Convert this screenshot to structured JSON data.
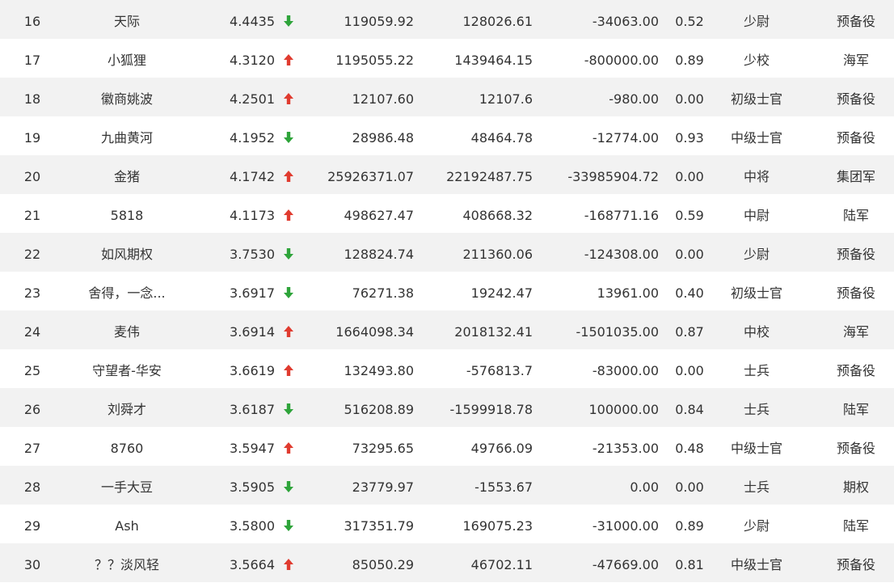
{
  "colors": {
    "up": "#e03b2f",
    "down": "#2ea43a",
    "row_stripe": "#f2f2f2",
    "text": "#333333"
  },
  "rows": [
    {
      "rank": "16",
      "name": "天际",
      "score": "4.4435",
      "trend": "down",
      "value1": "119059.92",
      "value2": "128026.61",
      "value3": "-34063.00",
      "ratio": "0.52",
      "title": "少尉",
      "unit": "预备役"
    },
    {
      "rank": "17",
      "name": "小狐狸",
      "score": "4.3120",
      "trend": "up",
      "value1": "1195055.22",
      "value2": "1439464.15",
      "value3": "-800000.00",
      "ratio": "0.89",
      "title": "少校",
      "unit": "海军"
    },
    {
      "rank": "18",
      "name": "徽商姚波",
      "score": "4.2501",
      "trend": "up",
      "value1": "12107.60",
      "value2": "12107.6",
      "value3": "-980.00",
      "ratio": "0.00",
      "title": "初级士官",
      "unit": "预备役"
    },
    {
      "rank": "19",
      "name": "九曲黄河",
      "score": "4.1952",
      "trend": "down",
      "value1": "28986.48",
      "value2": "48464.78",
      "value3": "-12774.00",
      "ratio": "0.93",
      "title": "中级士官",
      "unit": "预备役"
    },
    {
      "rank": "20",
      "name": "金猪",
      "score": "4.1742",
      "trend": "up",
      "value1": "25926371.07",
      "value2": "22192487.75",
      "value3": "-33985904.72",
      "ratio": "0.00",
      "title": "中将",
      "unit": "集团军"
    },
    {
      "rank": "21",
      "name": "5818",
      "score": "4.1173",
      "trend": "up",
      "value1": "498627.47",
      "value2": "408668.32",
      "value3": "-168771.16",
      "ratio": "0.59",
      "title": "中尉",
      "unit": "陆军"
    },
    {
      "rank": "22",
      "name": "如风期权",
      "score": "3.7530",
      "trend": "down",
      "value1": "128824.74",
      "value2": "211360.06",
      "value3": "-124308.00",
      "ratio": "0.00",
      "title": "少尉",
      "unit": "预备役"
    },
    {
      "rank": "23",
      "name": "舍得，一念...",
      "score": "3.6917",
      "trend": "down",
      "value1": "76271.38",
      "value2": "19242.47",
      "value3": "13961.00",
      "ratio": "0.40",
      "title": "初级士官",
      "unit": "预备役"
    },
    {
      "rank": "24",
      "name": "麦伟",
      "score": "3.6914",
      "trend": "up",
      "value1": "1664098.34",
      "value2": "2018132.41",
      "value3": "-1501035.00",
      "ratio": "0.87",
      "title": "中校",
      "unit": "海军"
    },
    {
      "rank": "25",
      "name": "守望者-华安",
      "score": "3.6619",
      "trend": "up",
      "value1": "132493.80",
      "value2": "-576813.7",
      "value3": "-83000.00",
      "ratio": "0.00",
      "title": "士兵",
      "unit": "预备役"
    },
    {
      "rank": "26",
      "name": "刘舜才",
      "score": "3.6187",
      "trend": "down",
      "value1": "516208.89",
      "value2": "-1599918.78",
      "value3": "100000.00",
      "ratio": "0.84",
      "title": "士兵",
      "unit": "陆军"
    },
    {
      "rank": "27",
      "name": "8760",
      "score": "3.5947",
      "trend": "up",
      "value1": "73295.65",
      "value2": "49766.09",
      "value3": "-21353.00",
      "ratio": "0.48",
      "title": "中级士官",
      "unit": "预备役"
    },
    {
      "rank": "28",
      "name": "一手大豆",
      "score": "3.5905",
      "trend": "down",
      "value1": "23779.97",
      "value2": "-1553.67",
      "value3": "0.00",
      "ratio": "0.00",
      "title": "士兵",
      "unit": "期权"
    },
    {
      "rank": "29",
      "name": "Ash",
      "score": "3.5800",
      "trend": "down",
      "value1": "317351.79",
      "value2": "169075.23",
      "value3": "-31000.00",
      "ratio": "0.89",
      "title": "少尉",
      "unit": "陆军"
    },
    {
      "rank": "30",
      "name": "？？淡风轻",
      "score": "3.5664",
      "trend": "up",
      "value1": "85050.29",
      "value2": "46702.11",
      "value3": "-47669.00",
      "ratio": "0.81",
      "title": "中级士官",
      "unit": "预备役"
    }
  ]
}
